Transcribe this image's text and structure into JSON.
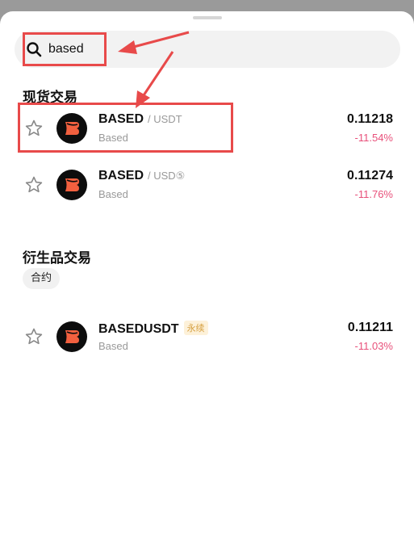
{
  "search": {
    "value": "based"
  },
  "spot": {
    "title": "现货交易",
    "items": [
      {
        "name": "BASED",
        "pair": "/ USDT",
        "sub": "Based",
        "price": "0.11218",
        "change": "-11.54%"
      },
      {
        "name": "BASED",
        "pair": "/ USD⑤",
        "sub": "Based",
        "price": "0.11274",
        "change": "-11.76%"
      }
    ]
  },
  "derivatives": {
    "title": "衍生品交易",
    "chip": "合约",
    "items": [
      {
        "name": "BASEDUSDT",
        "badge": "永续",
        "sub": "Based",
        "price": "0.11211",
        "change": "-11.03%"
      }
    ]
  },
  "colors": {
    "negative": "#e8507a",
    "annotation": "#e84a4a",
    "coin_accent": "#f2603f"
  }
}
